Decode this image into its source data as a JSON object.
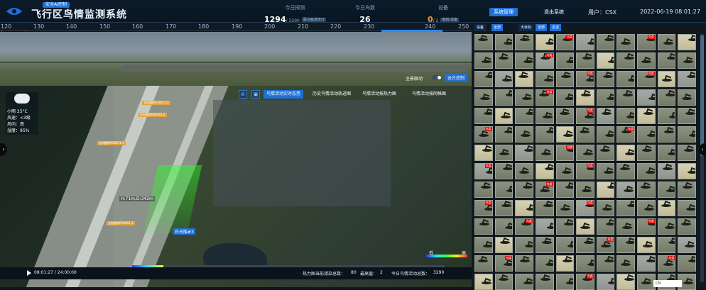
{
  "header": {
    "badge": "安全AI控制",
    "title": "飞行区鸟情监测系统",
    "stats": [
      {
        "label": "今日探测",
        "value": "1294",
        "sub": "/ 3290",
        "tag": "驱鸟触发统计"
      },
      {
        "label": "今日鸟数",
        "value": "26",
        "sub": "",
        "tag": ""
      },
      {
        "label": "设备",
        "value": "0",
        "sub": "/ 2",
        "tag": "离线/设备"
      }
    ],
    "system_button": "系统管理",
    "logout_button": "退出系统",
    "user": "用户：CSX",
    "datetime": "2022-06-19 08:01:27"
  },
  "ruler": {
    "ticks": [
      "120",
      "130",
      "140",
      "150",
      "160",
      "170",
      "180",
      "190",
      "200",
      "210",
      "220",
      "230",
      "240",
      "250"
    ]
  },
  "camera_tag": "白光版#3",
  "pano": {
    "auto_label": "全景联动",
    "ptz_button": "云台控制"
  },
  "map": {
    "weather": {
      "icon": "cloud-rain-icon",
      "lines": [
        "小雨  25°C",
        "风速：<3级",
        "风向：南",
        "湿度：95%"
      ]
    },
    "tabs": [
      "鸟情活动实时态势",
      "历史鸟情活动轨迹图",
      "鸟情活动按热力图",
      "鸟情活动按网格图"
    ],
    "labels": [
      "全向跟踪R360X1.5",
      "全向跟踪R360X1.4",
      "全向跟踪R360X1.3",
      "全向跟踪R360X1.1"
    ],
    "height_info": "H:71m,D:342m",
    "camera_label": "白光版#3",
    "legend_low": "低",
    "legend_high": "高"
  },
  "bottom": {
    "time": "08:01:27 / 24:00:00",
    "heat_total": "热力图当前滤染总数：",
    "heat_total_val": "80",
    "max_label": "最高值：",
    "max_val": "2",
    "today_total": "今日鸟情活动总数：",
    "today_total_val": "3290"
  },
  "filters": [
    "设备",
    "全部",
    "大目标",
    "全部",
    "多选"
  ],
  "gallery_tags": [
    "鸟类"
  ],
  "lang": "CN"
}
